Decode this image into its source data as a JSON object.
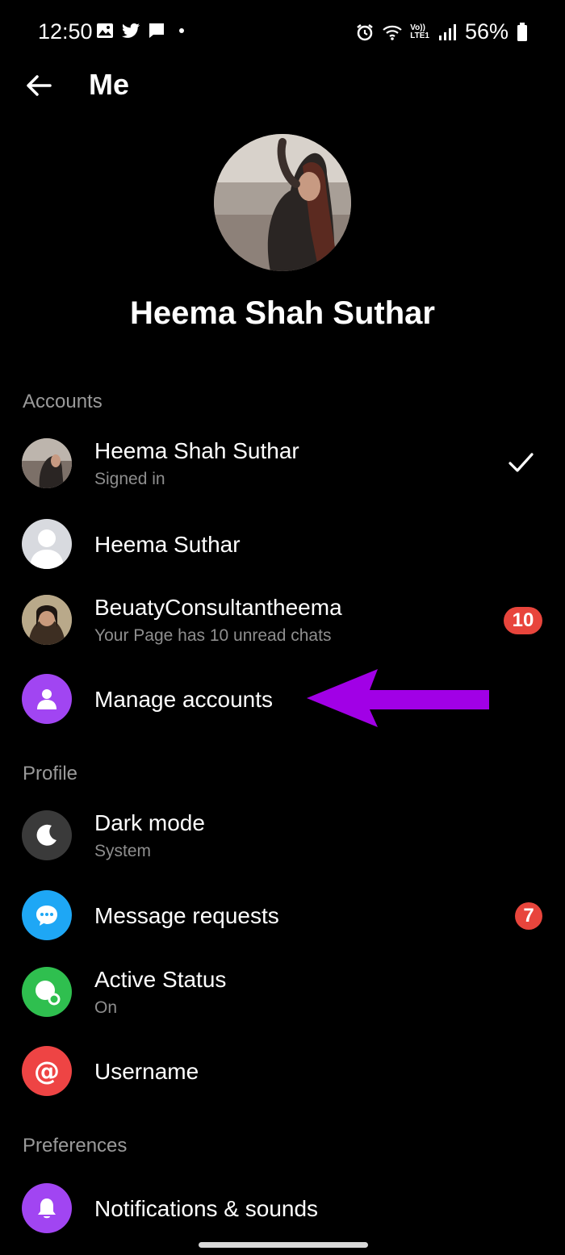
{
  "status_bar": {
    "time": "12:50",
    "battery": "56%",
    "left_icons": [
      "gallery-icon",
      "twitter-icon",
      "chat-icon"
    ],
    "right_icons": [
      "alarm-icon",
      "wifi-icon",
      "volte-icon",
      "signal-icon",
      "battery-icon"
    ],
    "volte_line1": "Vo))",
    "volte_line2": "LTE1"
  },
  "header": {
    "title": "Me"
  },
  "profile": {
    "name": "Heema Shah Suthar"
  },
  "sections": {
    "accounts": "Accounts",
    "profile": "Profile",
    "preferences": "Preferences"
  },
  "accounts": [
    {
      "label": "Heema Shah Suthar",
      "sub": "Signed in",
      "checked": true
    },
    {
      "label": "Heema Suthar"
    },
    {
      "label": "BeuatyConsultantheema",
      "sub": "Your Page has 10 unread chats",
      "badge": "10"
    },
    {
      "label": "Manage accounts"
    }
  ],
  "profile_items": [
    {
      "label": "Dark mode",
      "sub": "System",
      "icon": "moon-icon",
      "color": "#3a3a3a"
    },
    {
      "label": "Message requests",
      "icon": "chat-bubble-icon",
      "color": "#1ea7f5",
      "badge": "7"
    },
    {
      "label": "Active Status",
      "sub": "On",
      "icon": "active-status-icon",
      "color": "#2fbf4f"
    },
    {
      "label": "Username",
      "icon": "at-sign-icon",
      "color": "#ee4444"
    }
  ],
  "preferences_items": [
    {
      "label": "Notifications & sounds",
      "icon": "bell-icon",
      "color": "#a145f2"
    }
  ],
  "colors": {
    "accent_purple": "#a145f2",
    "annotation_arrow": "#a100e6",
    "badge_red": "#e8453c"
  }
}
